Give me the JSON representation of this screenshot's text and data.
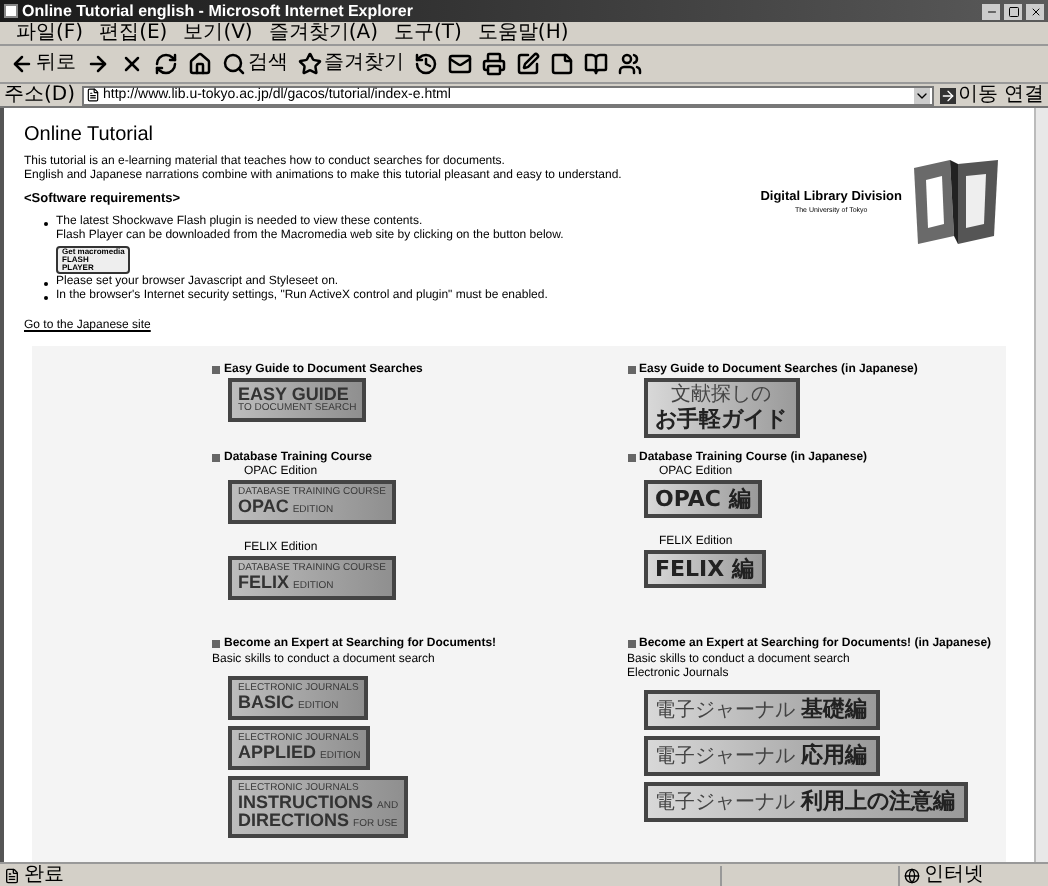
{
  "window": {
    "title": "Online Tutorial english - Microsoft Internet Explorer"
  },
  "menu": [
    "파일(F)",
    "편집(E)",
    "보기(V)",
    "즐겨찾기(A)",
    "도구(T)",
    "도움말(H)"
  ],
  "toolbar": [
    {
      "kind": "back",
      "label": "뒤로"
    },
    {
      "kind": "forward"
    },
    {
      "kind": "stop"
    },
    {
      "kind": "refresh"
    },
    {
      "kind": "home"
    },
    {
      "kind": "search",
      "label": "검색"
    },
    {
      "kind": "favorites",
      "label": "즐겨찾기"
    },
    {
      "kind": "history"
    },
    {
      "kind": "mail"
    },
    {
      "kind": "print"
    },
    {
      "kind": "edit"
    },
    {
      "kind": "discuss"
    },
    {
      "kind": "research"
    },
    {
      "kind": "messenger"
    }
  ],
  "address": {
    "label": "주소(D)",
    "url": "http://www.lib.u-tokyo.ac.jp/dl/gacos/tutorial/index-e.html",
    "go": "이동",
    "links": "연결"
  },
  "page": {
    "title": "Online Tutorial",
    "intro": [
      "This tutorial is an e-learning material that teaches how to conduct searches for documents.",
      "English and Japanese narrations combine with animations to make this tutorial pleasant and easy to understand."
    ],
    "requirements_heading": "<Software requirements>",
    "requirements": [
      {
        "kind": "text",
        "lines": [
          "The latest Shockwave Flash plugin is needed to view these contents.",
          "Flash Player can be downloaded from the Macromedia web site by clicking on the button below."
        ],
        "badge": [
          "Get macromedia",
          "FLASH",
          "PLAYER"
        ]
      },
      {
        "kind": "text",
        "lines": [
          "Please set your browser Javascript and Styleseet on."
        ]
      },
      {
        "kind": "text",
        "lines": [
          "In the browser's Internet security settings, \"Run ActiveX control and plugin\" must be enabled."
        ]
      }
    ],
    "logo": {
      "name": "Digital Library Division",
      "subtitle": "The University of Tokyo"
    },
    "japanese_link": "Go to the Japanese site",
    "rows": [
      [
        {
          "heading": "Easy Guide to Document Searches",
          "entries": [
            {
              "banner": {
                "kind": "en",
                "lines": [
                  [
                    {
                      "text": "EASY GUIDE",
                      "big": true
                    }
                  ],
                  [
                    {
                      "text": "TO DOCUMENT SEARCH",
                      "big": false
                    }
                  ]
                ]
              }
            }
          ]
        },
        {
          "heading": "Easy Guide to Document Searches (in Japanese)",
          "entries": [
            {
              "banner": {
                "kind": "ja",
                "lines": [
                  [
                    {
                      "text": "文献探しの",
                      "big": false
                    }
                  ],
                  [
                    {
                      "text": "お手軽ガイド",
                      "big": true
                    }
                  ]
                ]
              }
            }
          ]
        }
      ],
      [
        {
          "heading": "Database Training Course",
          "entries": [
            {
              "caption": "OPAC Edition",
              "banner": {
                "kind": "en",
                "lines": [
                  [
                    {
                      "text": "DATABASE TRAINING COURSE",
                      "big": false
                    }
                  ],
                  [
                    {
                      "text": "OPAC",
                      "big": true
                    },
                    {
                      "text": "EDITION",
                      "big": false
                    }
                  ]
                ]
              }
            },
            {
              "caption": "FELIX Edition",
              "banner": {
                "kind": "en",
                "lines": [
                  [
                    {
                      "text": "DATABASE TRAINING COURSE",
                      "big": false
                    }
                  ],
                  [
                    {
                      "text": "FELIX",
                      "big": true
                    },
                    {
                      "text": "EDITION",
                      "big": false
                    }
                  ]
                ]
              }
            }
          ]
        },
        {
          "heading": "Database Training Course (in Japanese)",
          "entries": [
            {
              "caption": "OPAC Edition",
              "banner": {
                "kind": "ja",
                "lines": [
                  [
                    {
                      "text": "OPAC 編",
                      "big": true
                    }
                  ]
                ]
              }
            },
            {
              "caption": "FELIX Edition",
              "banner": {
                "kind": "ja",
                "lines": [
                  [
                    {
                      "text": "FELIX 編",
                      "big": true
                    }
                  ]
                ]
              }
            }
          ]
        }
      ],
      [
        {
          "heading": "Become an Expert at Searching for Documents!",
          "notes": [
            "Basic skills to conduct a document search"
          ],
          "entries": [
            {
              "banner": {
                "kind": "en",
                "lines": [
                  [
                    {
                      "text": "ELECTRONIC JOURNALS",
                      "big": false
                    }
                  ],
                  [
                    {
                      "text": "BASIC",
                      "big": true
                    },
                    {
                      "text": "EDITION",
                      "big": false
                    }
                  ]
                ]
              }
            },
            {
              "banner": {
                "kind": "en",
                "lines": [
                  [
                    {
                      "text": "ELECTRONIC JOURNALS",
                      "big": false
                    }
                  ],
                  [
                    {
                      "text": "APPLIED",
                      "big": true
                    },
                    {
                      "text": "EDITION",
                      "big": false
                    }
                  ]
                ]
              }
            },
            {
              "banner": {
                "kind": "en",
                "lines": [
                  [
                    {
                      "text": "ELECTRONIC JOURNALS",
                      "big": false
                    }
                  ],
                  [
                    {
                      "text": "INSTRUCTIONS",
                      "big": true
                    },
                    {
                      "text": "AND",
                      "big": false
                    }
                  ],
                  [
                    {
                      "text": "DIRECTIONS",
                      "big": true
                    },
                    {
                      "text": "FOR USE",
                      "big": false
                    }
                  ]
                ]
              }
            }
          ]
        },
        {
          "heading": "Become an Expert at Searching for Documents! (in Japanese)",
          "notes": [
            "Basic skills to conduct a document search",
            "Electronic Journals"
          ],
          "entries": [
            {
              "banner": {
                "kind": "ja",
                "lines": [
                  [
                    {
                      "text": "電子ジャーナル",
                      "big": false
                    },
                    {
                      "text": "基礎編",
                      "big": true
                    }
                  ]
                ]
              }
            },
            {
              "banner": {
                "kind": "ja",
                "lines": [
                  [
                    {
                      "text": "電子ジャーナル",
                      "big": false
                    },
                    {
                      "text": "応用編",
                      "big": true
                    }
                  ]
                ]
              }
            },
            {
              "banner": {
                "kind": "ja",
                "lines": [
                  [
                    {
                      "text": "電子ジャーナル",
                      "big": false
                    },
                    {
                      "text": "利用上の注意編",
                      "big": true
                    }
                  ]
                ]
              }
            }
          ]
        }
      ]
    ]
  },
  "status": {
    "text": "완료",
    "zone": "인터넷"
  }
}
